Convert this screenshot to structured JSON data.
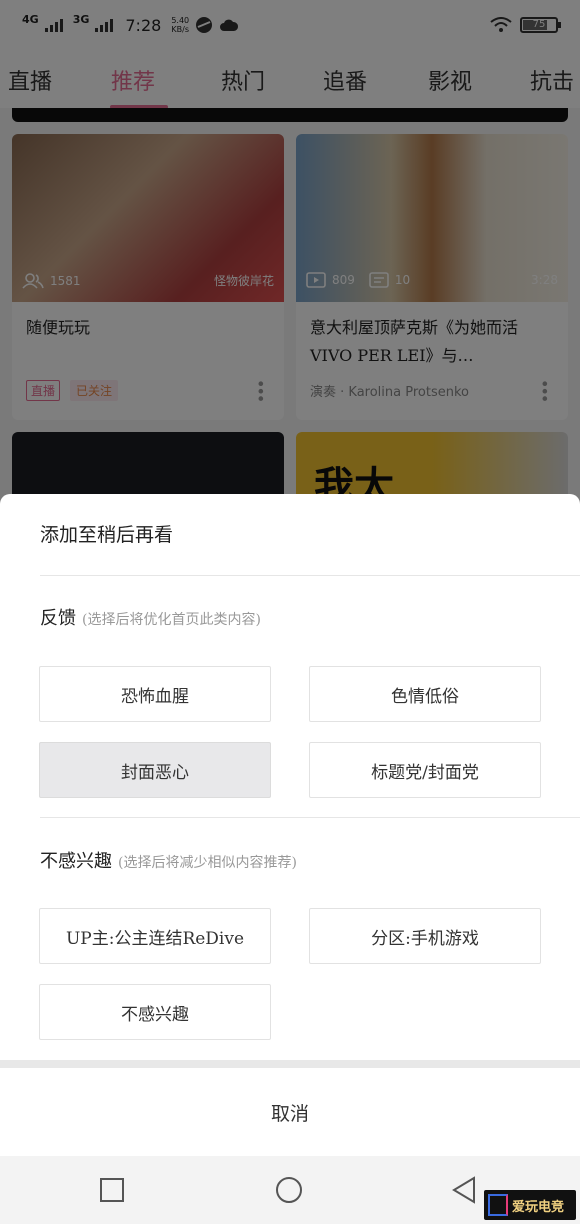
{
  "status_bar": {
    "network1": "4G",
    "network2": "3G",
    "time": "7:28",
    "speed_value": "5.40",
    "speed_unit": "KB/s",
    "battery": "75"
  },
  "tabs": [
    {
      "label": "直播"
    },
    {
      "label": "推荐"
    },
    {
      "label": "热门"
    },
    {
      "label": "追番"
    },
    {
      "label": "影视"
    },
    {
      "label": "抗击"
    }
  ],
  "active_tab": "推荐",
  "cards": [
    {
      "viewers": "1581",
      "uploader_overlay": "怪物彼岸花",
      "title": "随便玩玩",
      "live_badge": "直播",
      "follow_badge": "已关注"
    },
    {
      "plays": "809",
      "danmaku": "10",
      "duration": "3:28",
      "title": "意大利屋顶萨克斯《为她而活 VIVO PER LEI》与…",
      "subtitle": "演奏 · Karolina Protsenko"
    },
    {
      "thumb_text": "我太"
    }
  ],
  "sheet": {
    "watch_later": "添加至稍后再看",
    "feedback_title": "反馈",
    "feedback_hint": "(选择后将优化首页此类内容)",
    "feedback_options": [
      "恐怖血腥",
      "色情低俗",
      "封面恶心",
      "标题党/封面党"
    ],
    "pressed_option": "封面恶心",
    "dislike_title": "不感兴趣",
    "dislike_hint": "(选择后将减少相似内容推荐)",
    "dislike_options": [
      "UP主:公主连结ReDive",
      "分区:手机游戏",
      "不感兴趣"
    ],
    "cancel": "取消"
  },
  "colors": {
    "accent": "#e46d93",
    "follow": "#e8894a"
  }
}
